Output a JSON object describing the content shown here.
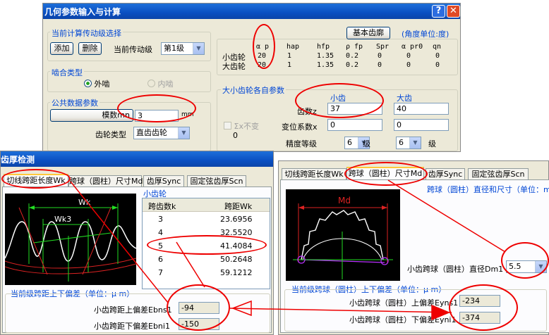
{
  "geom_dialog": {
    "title": "几何参数输入与计算",
    "stage_group_title": "当前计算传动级选择",
    "add_button": "添加",
    "delete_button": "删除",
    "stage_label": "当前传动级",
    "stage_value": "第1级",
    "basic_rack_button": "基本齿廓",
    "angle_unit": "(角度单位:度)",
    "rack_headers": [
      "α p",
      "hap",
      "hfp",
      "ρ fp",
      "Spr",
      "α pr0",
      "qn"
    ],
    "rack_rows": [
      {
        "label": "小齿轮",
        "values": [
          "20",
          "1",
          "1.35",
          "0.2",
          "0",
          "0",
          "0"
        ]
      },
      {
        "label": "大齿轮",
        "values": [
          "20",
          "1",
          "1.35",
          "0.2",
          "0",
          "0",
          "0"
        ]
      }
    ],
    "mesh_group_title": "啮合类型",
    "mesh_external": "外啮",
    "mesh_internal": "内啮",
    "common_group_title": "公共数据参数",
    "module_button": "模数mn",
    "module_value": "3",
    "module_unit": "mm",
    "gear_type_label": "齿轮类型",
    "gear_type_value": "直齿齿轮",
    "gear_params_group_title": "大小齿轮各自参数",
    "col_small": "小齿",
    "col_large": "大齿",
    "teeth_label": "齿数z",
    "teeth_small": "37",
    "teeth_large": "40",
    "shift_label": "变位系数x",
    "shift_small": "0",
    "shift_large": "0",
    "sum_x_label": "Σx不变",
    "sum_x_value": "0",
    "grade_label": "精度等级",
    "grade_small": "6",
    "grade_large": "6",
    "grade_unit": "级"
  },
  "thickness_dialog": {
    "title": "齿厚检测",
    "tabs": [
      "切线跨距长度Wk",
      "跨球（圆柱）尺寸Md",
      "齿厚Sync",
      "固定弦齿厚Scn"
    ],
    "drawing_labels": {
      "wk": "Wk",
      "wk3": "Wk3"
    },
    "table_group_title": "小齿轮",
    "table_headers": [
      "跨齿数k",
      "跨距Wk"
    ],
    "table_rows": [
      {
        "k": "3",
        "wk": "23.6956"
      },
      {
        "k": "4",
        "wk": "32.5520"
      },
      {
        "k": "5",
        "wk": "41.4084"
      },
      {
        "k": "6",
        "wk": "50.2648"
      },
      {
        "k": "7",
        "wk": "59.1212"
      }
    ],
    "deviation_group_title": "当前级跨距上下偏差（单位：μ m）",
    "upper_label": "小齿跨距上偏差Ebns1",
    "upper_value": "-94",
    "lower_label": "小齿跨距下偏差Ebni1",
    "lower_value": "-150"
  },
  "ball_dialog": {
    "tabs": [
      "切线跨距长度Wk",
      "跨球（圆柱）尺寸Md",
      "齿厚Sync",
      "固定弦齿厚Scn"
    ],
    "header_text": "跨球（圆柱）直径和尺寸（单位：mm",
    "drawing_label": "Md",
    "diameter_label": "小齿跨球（圆柱）直径Dm1",
    "diameter_value": "5.5",
    "deviation_group_title": "当前级跨球（圆柱）上下偏差（单位：μ m）",
    "upper_label": "小齿跨球（圆柱）上偏差Eyns1",
    "upper_value": "-234",
    "lower_label": "小齿跨球（圆柱）下偏差Eyni1",
    "lower_value": "-374"
  }
}
